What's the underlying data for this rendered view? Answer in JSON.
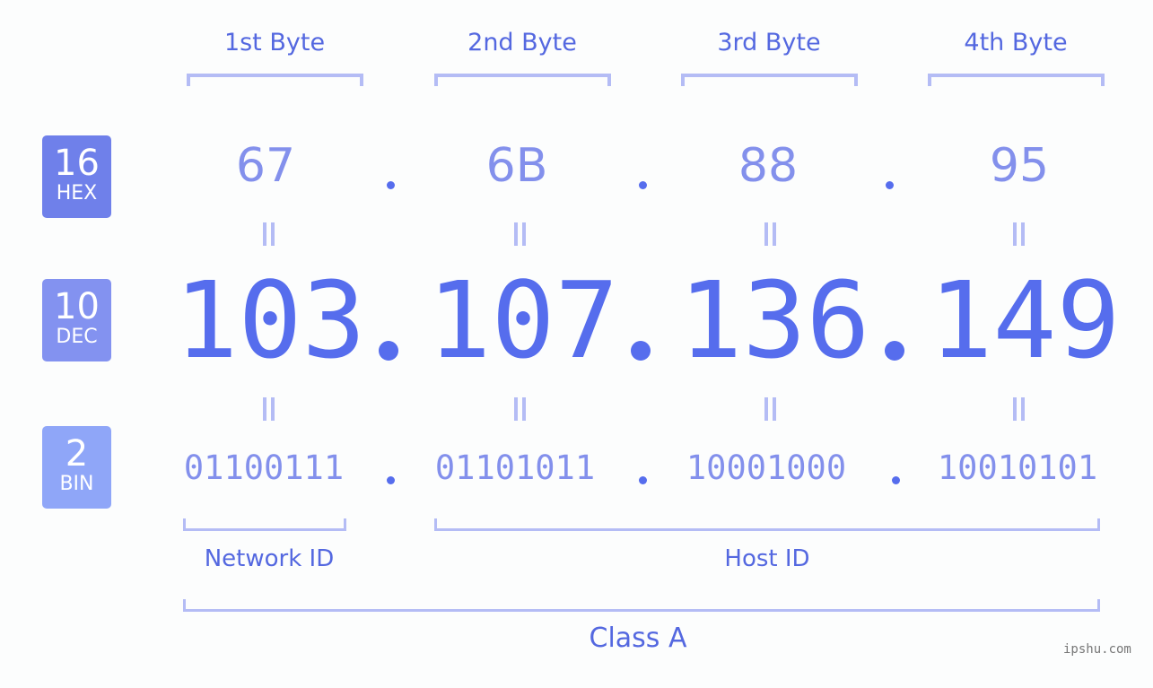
{
  "badges": [
    {
      "base": "16",
      "name": "HEX",
      "color": "#6f80ea"
    },
    {
      "base": "10",
      "name": "DEC",
      "color": "#8392f0"
    },
    {
      "base": "2",
      "name": "BIN",
      "color": "#8fa6f8"
    }
  ],
  "bytes": [
    {
      "title": "1st Byte",
      "hex": "67",
      "dec": "103",
      "bin": "01100111"
    },
    {
      "title": "2nd Byte",
      "hex": "6B",
      "dec": "107",
      "bin": "01101011"
    },
    {
      "title": "3rd Byte",
      "hex": "88",
      "dec": "136",
      "bin": "10001000"
    },
    {
      "title": "4th Byte",
      "hex": "95",
      "dec": "149",
      "bin": "10010101"
    }
  ],
  "segments": {
    "network": "Network ID",
    "host": "Host ID",
    "class": "Class A"
  },
  "watermark": "ipshu.com",
  "colors": {
    "accent": "#566ded",
    "bracket": "#b4bcf5",
    "text": "#5468e0"
  }
}
